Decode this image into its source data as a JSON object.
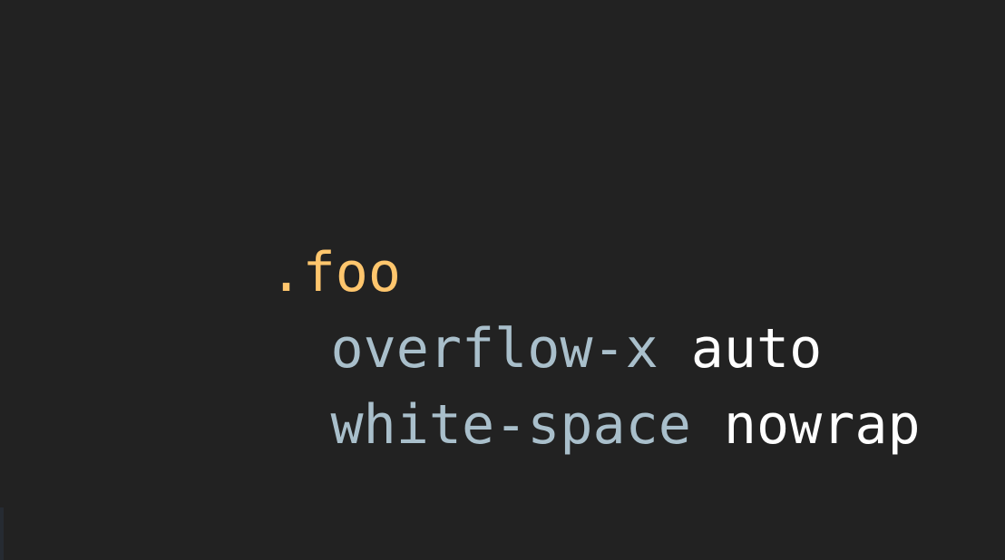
{
  "colors": {
    "background": "#222222",
    "selector": "#FFC66D",
    "property": "#A9BFCB",
    "value": "#FFFFFF"
  },
  "code": {
    "selector": ".foo",
    "declarations": [
      {
        "property": "overflow-x",
        "value": "auto"
      },
      {
        "property": "white-space",
        "value": "nowrap"
      }
    ]
  }
}
